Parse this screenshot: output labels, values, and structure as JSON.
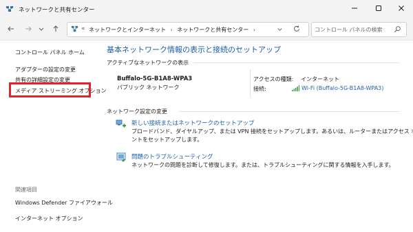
{
  "window": {
    "title": "ネットワークと共有センター"
  },
  "nav": {
    "breadcrumb_sep": "«",
    "breadcrumb": [
      "ネットワークとインターネット",
      "ネットワークと共有センター"
    ],
    "search_placeholder": "コントロール パネルの検索"
  },
  "sidebar": {
    "links": [
      "コントロール パネル ホーム",
      "アダプターの設定の変更",
      "共有の詳細設定の変更",
      "メディア ストリーミング オプション"
    ],
    "related_heading": "関連項目",
    "related": [
      "Windows Defender ファイアウォール",
      "インターネット オプション"
    ]
  },
  "main": {
    "title": "基本ネットワーク情報の表示と接続のセットアップ",
    "active_networks_label": "アクティブなネットワークの表示",
    "network_name": "Buffalo-5G-B1A8-WPA3",
    "network_type": "パブリック ネットワーク",
    "access_type_label": "アクセスの種類:",
    "access_type_value": "インターネット",
    "connections_label": "接続:",
    "connections_value": "Wi-Fi (Buffalo-5G-B1A8-WPA3)",
    "change_settings_label": "ネットワーク設定の変更",
    "tasks": [
      {
        "link": "新しい接続またはネットワークのセットアップ",
        "desc": "ブロードバンド、ダイヤルアップ、または VPN 接続をセットアップします。あるいは、ルーターまたはアクセス ポイントをセットアップします。"
      },
      {
        "link": "問題のトラブルシューティング",
        "desc": "ネットワークの問題を診断して修復します。または、トラブルシューティングに関する情報を入手します。"
      }
    ]
  },
  "colors": {
    "accent": "#1e5fa8",
    "highlight": "#e3232c"
  }
}
